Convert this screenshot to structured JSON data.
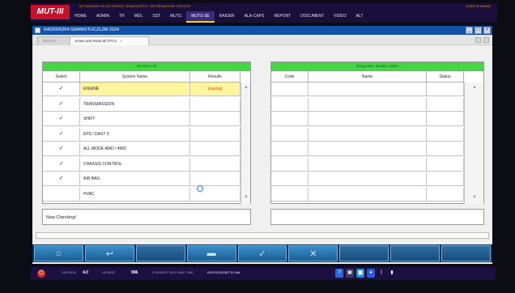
{
  "topbar": {
    "logo": "MUT-III",
    "subtitle": "MITSUBISHI ELECTRONIC DIAGNOSTIC INFORMATION CENTER",
    "user": "USER ID  FAHAD",
    "menu": [
      "HOME",
      "ADMIN",
      "TR",
      "MDL",
      "SST",
      "MUTS",
      "MUTS-SE",
      "RAIDER",
      "ALA-CAPS",
      "REPORT",
      "DOCUMENT",
      "VIDEO",
      "ALT"
    ],
    "active_index": 6
  },
  "window": {
    "title": "N402005204  GM4WXTUCZL2M 2024",
    "tabs": [
      {
        "label": "MUTSS"
      },
      {
        "label": "Erase and Read all DTCs"
      }
    ]
  },
  "system_list": {
    "header": "System List",
    "columns": [
      "Select",
      "System Name",
      "Results"
    ],
    "rows": [
      {
        "select": "✓",
        "name": "ENGINE",
        "result": "Erasing!",
        "highlight": true
      },
      {
        "select": "✓",
        "name": "TRANSMISSION",
        "result": ""
      },
      {
        "select": "✓",
        "name": "SHIFT",
        "result": ""
      },
      {
        "select": "✓",
        "name": "EPS / DAST 3",
        "result": ""
      },
      {
        "select": "✓",
        "name": "ALL MODE AWD / 4WD",
        "result": ""
      },
      {
        "select": "✓",
        "name": "CHASSIS CONTROL",
        "result": ""
      },
      {
        "select": "✓",
        "name": "AIR BAG",
        "result": ""
      },
      {
        "select": "",
        "name": "HVAC",
        "result": ""
      }
    ]
  },
  "dtc_list": {
    "header": "Diagnostic trouble codes",
    "columns": [
      "Code",
      "Name",
      "Status"
    ],
    "row_count": 8
  },
  "status_text": "Now Checking!",
  "buttons": [
    "home-icon",
    "back-icon",
    "blank",
    "folder-icon",
    "check-icon",
    "cancel-icon",
    "blank",
    "blank",
    "blank"
  ],
  "taskbar": {
    "version_label": "VERSION",
    "version_value": "4.0",
    "update_label": "UPDATE",
    "update_value": "996",
    "date_label": "CURRENT DATE AND TIME",
    "date_value": "01/07/2025 $27:31 AM"
  }
}
